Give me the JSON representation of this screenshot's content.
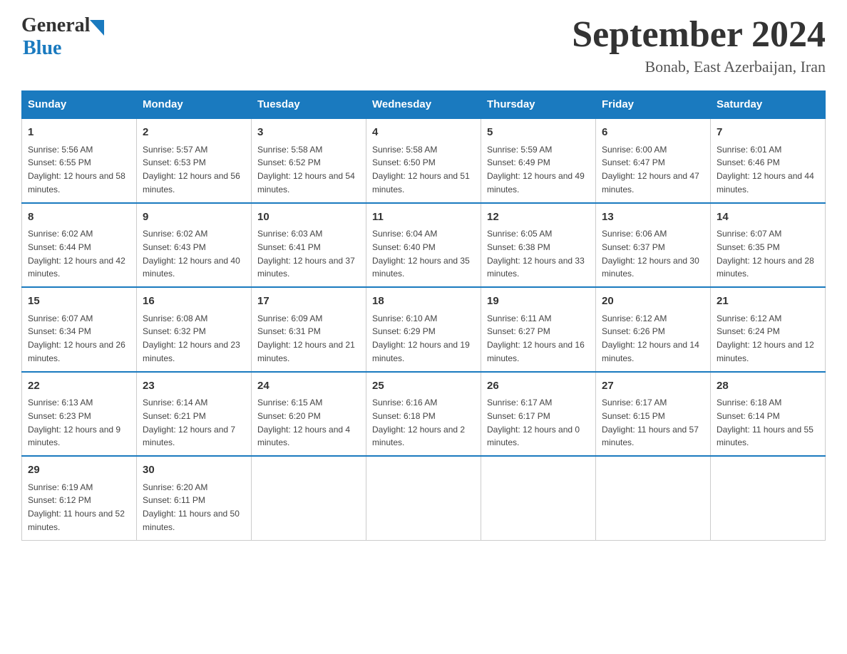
{
  "logo": {
    "general": "General",
    "blue": "Blue"
  },
  "title": "September 2024",
  "subtitle": "Bonab, East Azerbaijan, Iran",
  "days_of_week": [
    "Sunday",
    "Monday",
    "Tuesday",
    "Wednesday",
    "Thursday",
    "Friday",
    "Saturday"
  ],
  "weeks": [
    [
      {
        "day": "1",
        "sunrise": "5:56 AM",
        "sunset": "6:55 PM",
        "daylight": "12 hours and 58 minutes."
      },
      {
        "day": "2",
        "sunrise": "5:57 AM",
        "sunset": "6:53 PM",
        "daylight": "12 hours and 56 minutes."
      },
      {
        "day": "3",
        "sunrise": "5:58 AM",
        "sunset": "6:52 PM",
        "daylight": "12 hours and 54 minutes."
      },
      {
        "day": "4",
        "sunrise": "5:58 AM",
        "sunset": "6:50 PM",
        "daylight": "12 hours and 51 minutes."
      },
      {
        "day": "5",
        "sunrise": "5:59 AM",
        "sunset": "6:49 PM",
        "daylight": "12 hours and 49 minutes."
      },
      {
        "day": "6",
        "sunrise": "6:00 AM",
        "sunset": "6:47 PM",
        "daylight": "12 hours and 47 minutes."
      },
      {
        "day": "7",
        "sunrise": "6:01 AM",
        "sunset": "6:46 PM",
        "daylight": "12 hours and 44 minutes."
      }
    ],
    [
      {
        "day": "8",
        "sunrise": "6:02 AM",
        "sunset": "6:44 PM",
        "daylight": "12 hours and 42 minutes."
      },
      {
        "day": "9",
        "sunrise": "6:02 AM",
        "sunset": "6:43 PM",
        "daylight": "12 hours and 40 minutes."
      },
      {
        "day": "10",
        "sunrise": "6:03 AM",
        "sunset": "6:41 PM",
        "daylight": "12 hours and 37 minutes."
      },
      {
        "day": "11",
        "sunrise": "6:04 AM",
        "sunset": "6:40 PM",
        "daylight": "12 hours and 35 minutes."
      },
      {
        "day": "12",
        "sunrise": "6:05 AM",
        "sunset": "6:38 PM",
        "daylight": "12 hours and 33 minutes."
      },
      {
        "day": "13",
        "sunrise": "6:06 AM",
        "sunset": "6:37 PM",
        "daylight": "12 hours and 30 minutes."
      },
      {
        "day": "14",
        "sunrise": "6:07 AM",
        "sunset": "6:35 PM",
        "daylight": "12 hours and 28 minutes."
      }
    ],
    [
      {
        "day": "15",
        "sunrise": "6:07 AM",
        "sunset": "6:34 PM",
        "daylight": "12 hours and 26 minutes."
      },
      {
        "day": "16",
        "sunrise": "6:08 AM",
        "sunset": "6:32 PM",
        "daylight": "12 hours and 23 minutes."
      },
      {
        "day": "17",
        "sunrise": "6:09 AM",
        "sunset": "6:31 PM",
        "daylight": "12 hours and 21 minutes."
      },
      {
        "day": "18",
        "sunrise": "6:10 AM",
        "sunset": "6:29 PM",
        "daylight": "12 hours and 19 minutes."
      },
      {
        "day": "19",
        "sunrise": "6:11 AM",
        "sunset": "6:27 PM",
        "daylight": "12 hours and 16 minutes."
      },
      {
        "day": "20",
        "sunrise": "6:12 AM",
        "sunset": "6:26 PM",
        "daylight": "12 hours and 14 minutes."
      },
      {
        "day": "21",
        "sunrise": "6:12 AM",
        "sunset": "6:24 PM",
        "daylight": "12 hours and 12 minutes."
      }
    ],
    [
      {
        "day": "22",
        "sunrise": "6:13 AM",
        "sunset": "6:23 PM",
        "daylight": "12 hours and 9 minutes."
      },
      {
        "day": "23",
        "sunrise": "6:14 AM",
        "sunset": "6:21 PM",
        "daylight": "12 hours and 7 minutes."
      },
      {
        "day": "24",
        "sunrise": "6:15 AM",
        "sunset": "6:20 PM",
        "daylight": "12 hours and 4 minutes."
      },
      {
        "day": "25",
        "sunrise": "6:16 AM",
        "sunset": "6:18 PM",
        "daylight": "12 hours and 2 minutes."
      },
      {
        "day": "26",
        "sunrise": "6:17 AM",
        "sunset": "6:17 PM",
        "daylight": "12 hours and 0 minutes."
      },
      {
        "day": "27",
        "sunrise": "6:17 AM",
        "sunset": "6:15 PM",
        "daylight": "11 hours and 57 minutes."
      },
      {
        "day": "28",
        "sunrise": "6:18 AM",
        "sunset": "6:14 PM",
        "daylight": "11 hours and 55 minutes."
      }
    ],
    [
      {
        "day": "29",
        "sunrise": "6:19 AM",
        "sunset": "6:12 PM",
        "daylight": "11 hours and 52 minutes."
      },
      {
        "day": "30",
        "sunrise": "6:20 AM",
        "sunset": "6:11 PM",
        "daylight": "11 hours and 50 minutes."
      },
      null,
      null,
      null,
      null,
      null
    ]
  ]
}
